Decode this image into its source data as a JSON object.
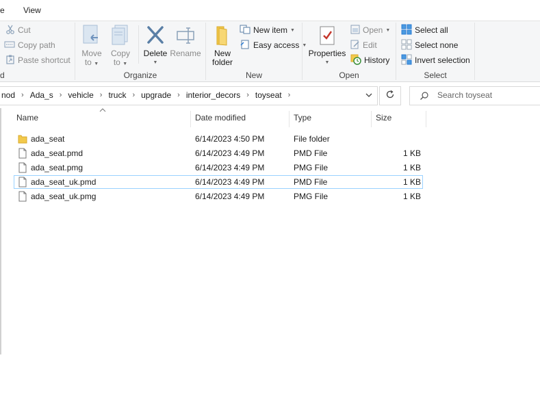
{
  "tabs": {
    "partial_left": "e",
    "view": "View"
  },
  "ribbon": {
    "clipboard": {
      "cut": "Cut",
      "copy_path": "Copy path",
      "paste_shortcut": "Paste shortcut",
      "partial_label": "d"
    },
    "organize": {
      "label": "Organize",
      "move_to_1": "Move",
      "move_to_2": "to",
      "copy_to_1": "Copy",
      "copy_to_2": "to",
      "delete": "Delete",
      "rename": "Rename"
    },
    "new": {
      "label": "New",
      "new_folder_1": "New",
      "new_folder_2": "folder",
      "new_item": "New item",
      "easy_access": "Easy access"
    },
    "open": {
      "label": "Open",
      "properties": "Properties",
      "open": "Open",
      "edit": "Edit",
      "history": "History"
    },
    "select": {
      "label": "Select",
      "select_all": "Select all",
      "select_none": "Select none",
      "invert_selection": "Invert selection"
    }
  },
  "address": {
    "crumbs": [
      "nod",
      "Ada_s",
      "vehicle",
      "truck",
      "upgrade",
      "interior_decors",
      "toyseat"
    ],
    "separator": "›"
  },
  "search": {
    "placeholder": "Search toyseat"
  },
  "columns": {
    "name": "Name",
    "date": "Date modified",
    "type": "Type",
    "size": "Size"
  },
  "files": [
    {
      "name": "ada_seat",
      "date": "6/14/2023 4:50 PM",
      "type": "File folder",
      "size": "",
      "kind": "folder"
    },
    {
      "name": "ada_seat.pmd",
      "date": "6/14/2023 4:49 PM",
      "type": "PMD File",
      "size": "1 KB",
      "kind": "file"
    },
    {
      "name": "ada_seat.pmg",
      "date": "6/14/2023 4:49 PM",
      "type": "PMG File",
      "size": "1 KB",
      "kind": "file"
    },
    {
      "name": "ada_seat_uk.pmd",
      "date": "6/14/2023 4:49 PM",
      "type": "PMD File",
      "size": "1 KB",
      "kind": "file",
      "selected": true
    },
    {
      "name": "ada_seat_uk.pmg",
      "date": "6/14/2023 4:49 PM",
      "type": "PMG File",
      "size": "1 KB",
      "kind": "file"
    }
  ],
  "colors": {
    "folder": "#f2c94c",
    "selection_border": "#99d1ff",
    "accent_blue": "#2b7cd3",
    "delete_red": "#c5372c"
  }
}
